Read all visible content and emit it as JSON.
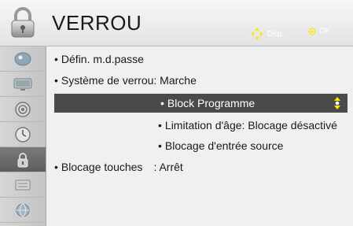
{
  "header": {
    "title": "VERROU",
    "move_hint": "Dép.",
    "ok_hint": "OK"
  },
  "sidebar": {
    "items": [
      {
        "icon": "picture-icon"
      },
      {
        "icon": "tv-icon"
      },
      {
        "icon": "speaker-icon"
      },
      {
        "icon": "clock-icon"
      },
      {
        "icon": "lock-icon",
        "active": true
      },
      {
        "icon": "options-icon"
      },
      {
        "icon": "network-icon"
      }
    ]
  },
  "menu": {
    "set_password": "Défin. m.d.passe",
    "lock_system": "Système de verrou: Marche",
    "block_program": "Block Programme",
    "age_limit": "Limitation d'âge: Blocage désactivé",
    "input_block": "Blocage d'entrée source",
    "key_lock_label": "Blocage touches",
    "key_lock_value": ": Arrêt"
  },
  "bullet": "•",
  "colors": {
    "highlight": "#4a4a4a",
    "sidebar_active": "#666666",
    "accent_hint": "#ffffff"
  }
}
